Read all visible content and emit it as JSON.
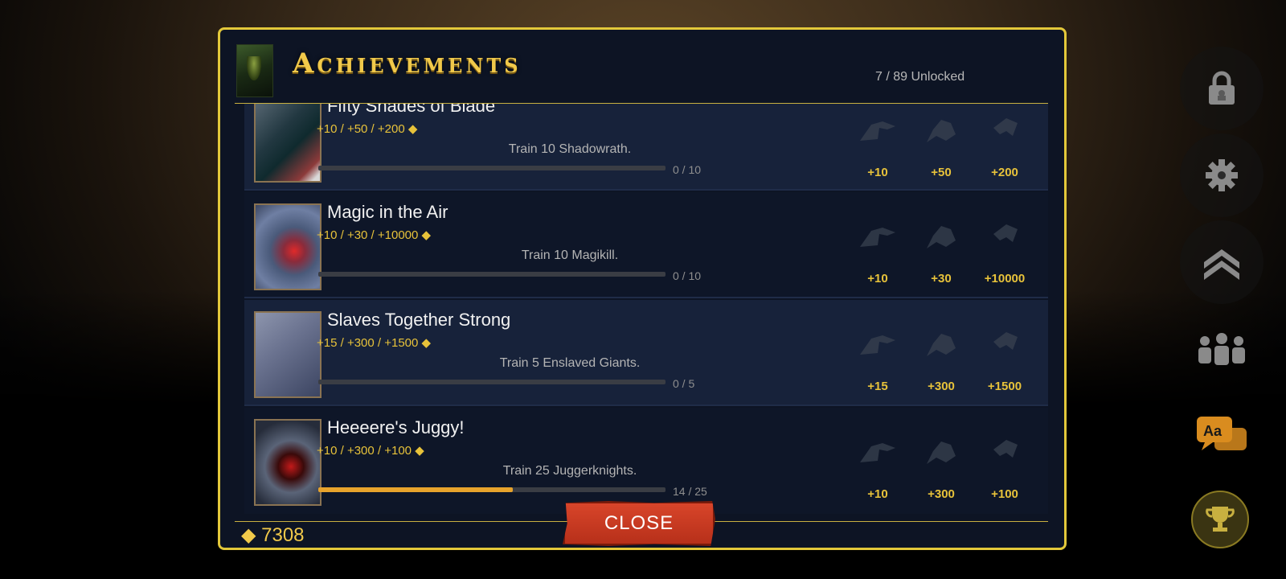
{
  "modal": {
    "title": "Achievements",
    "unlocked_text": "7 / 89 Unlocked",
    "gems": "7308",
    "close_label": "CLOSE"
  },
  "achievements": [
    {
      "name": "Fifty Shades of Blade",
      "rewards": "+10 / +50 / +200",
      "description": "Train 10 Shadowrath.",
      "progress_text": "0 / 10",
      "progress": 0.0,
      "tiers": [
        "+10",
        "+50",
        "+200"
      ]
    },
    {
      "name": "Magic in the Air",
      "rewards": "+10 / +30 / +10000",
      "description": "Train 10 Magikill.",
      "progress_text": "0 / 10",
      "progress": 0.0,
      "tiers": [
        "+10",
        "+30",
        "+10000"
      ]
    },
    {
      "name": "Slaves Together Strong",
      "rewards": "+15 / +300 / +1500",
      "description": "Train 5 Enslaved Giants.",
      "progress_text": "0 / 5",
      "progress": 0.0,
      "tiers": [
        "+15",
        "+300",
        "+1500"
      ]
    },
    {
      "name": "Heeeere's Juggy!",
      "rewards": "+10 / +300 / +100",
      "description": "Train 25 Juggerknights.",
      "progress_text": "14 / 25",
      "progress": 0.56,
      "tiers": [
        "+10",
        "+300",
        "+100"
      ]
    }
  ],
  "side_menu": {
    "icons": [
      "lock-icon",
      "gear-icon",
      "rank-chevron-icon",
      "group-icon",
      "language-icon",
      "trophy-icon"
    ]
  },
  "colors": {
    "accent_gold": "#e3c83a",
    "reward_yellow": "#e7c23a",
    "close_red": "#c8381f",
    "panel_bg": "#0d1424"
  }
}
